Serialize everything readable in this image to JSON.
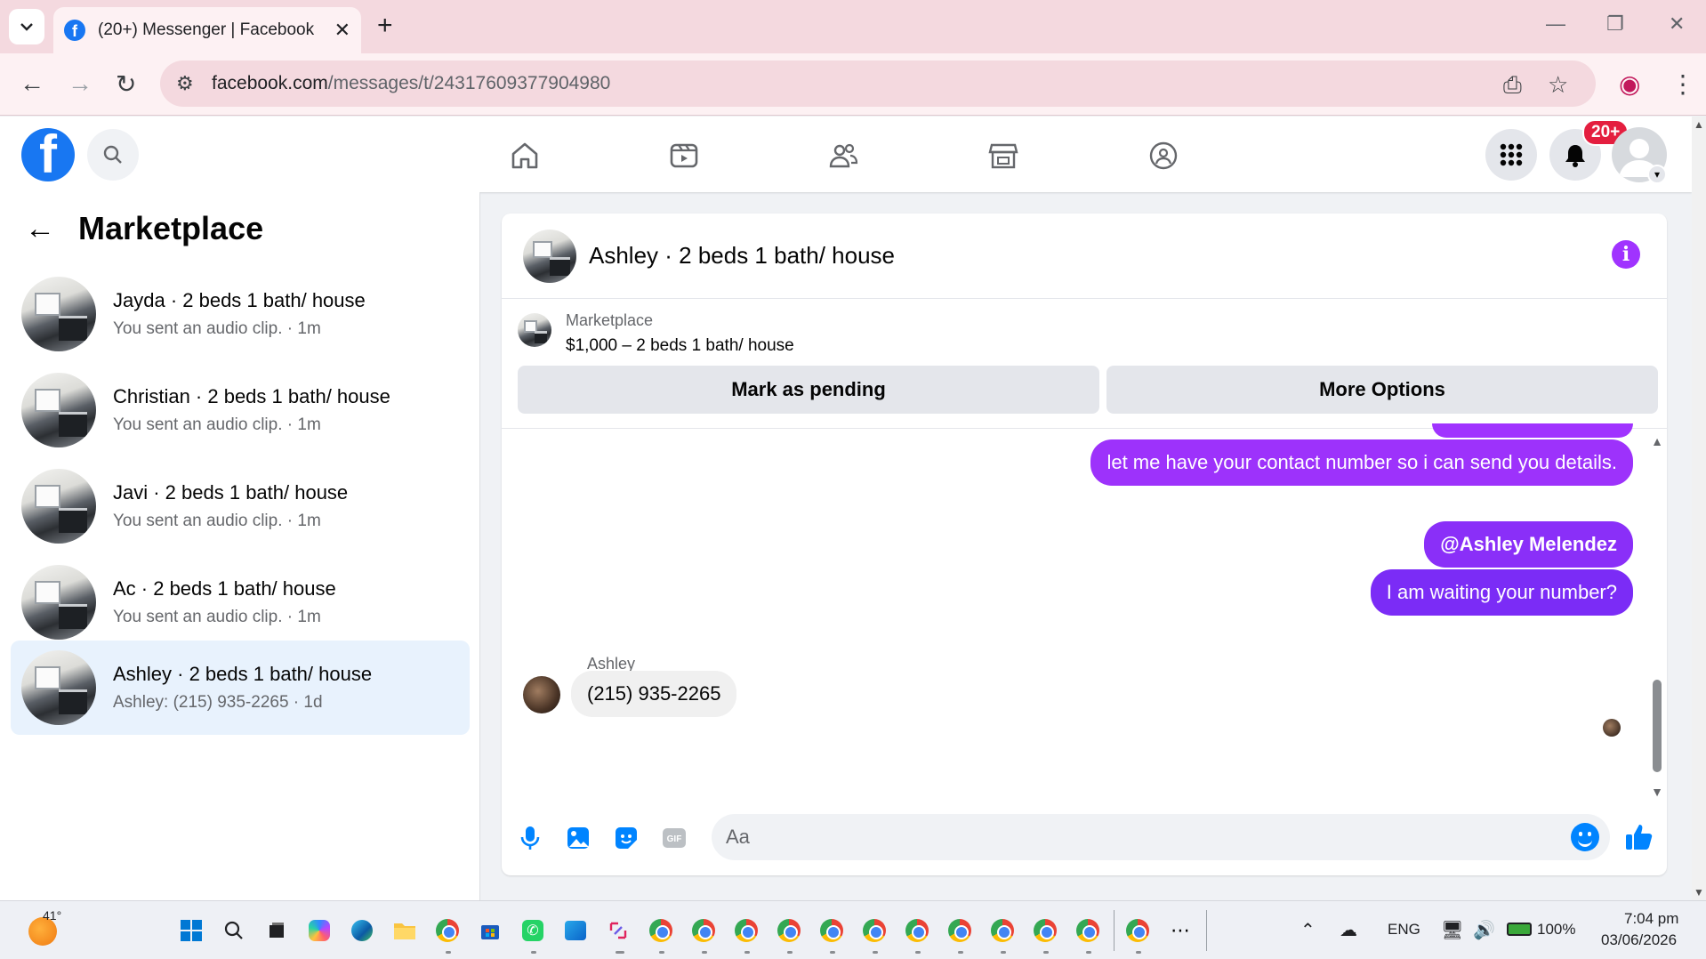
{
  "browser": {
    "tab_title": "(20+) Messenger | Facebook",
    "url_domain": "facebook.com",
    "url_path": "/messages/t/24317609377904980",
    "new_tab": "+",
    "tab_close": "✕"
  },
  "header": {
    "notification_badge": "20+"
  },
  "left_panel": {
    "title": "Marketplace",
    "conversations": [
      {
        "name": "Jayda · 2 beds 1 bath/ house",
        "sub": "You sent an audio clip. · 1m",
        "active": false
      },
      {
        "name": "Christian · 2 beds 1 bath/ house",
        "sub": "You sent an audio clip. · 1m",
        "active": false
      },
      {
        "name": "Javi · 2 beds 1 bath/ house",
        "sub": "You sent an audio clip. · 1m",
        "active": false
      },
      {
        "name": "Ac · 2 beds 1 bath/ house",
        "sub": "You sent an audio clip. · 1m",
        "active": false
      },
      {
        "name": "Ashley · 2 beds 1 bath/ house",
        "sub": "Ashley: (215) 935-2265 · 1d",
        "active": true
      }
    ]
  },
  "chat": {
    "title": "Ashley · 2 beds 1 bath/ house",
    "listing": {
      "label": "Marketplace",
      "price_title": "$1,000 – 2 beds 1 bath/ house"
    },
    "buttons": {
      "mark_pending": "Mark as pending",
      "more_options": "More Options"
    },
    "messages": [
      {
        "from": "me",
        "text": "let me have your contact number so i can send you details."
      },
      {
        "from": "me",
        "text": "@Ashley Melendez"
      },
      {
        "from": "me",
        "text": "I am waiting your number?"
      }
    ],
    "incoming": {
      "sender": "Ashley",
      "text": "(215) 935-2265"
    },
    "composer_placeholder": "Aa"
  },
  "taskbar": {
    "weather": "41°",
    "language": "ENG",
    "battery": "100%",
    "time": "7:04 pm",
    "date": "03/06/2026"
  },
  "colors": {
    "fb_blue": "#1877f2",
    "bubble_top": "#a033ff",
    "bubble_bottom": "#7b2cf6",
    "active_row": "#e8f2fd",
    "messenger_blue": "#0084ff"
  }
}
